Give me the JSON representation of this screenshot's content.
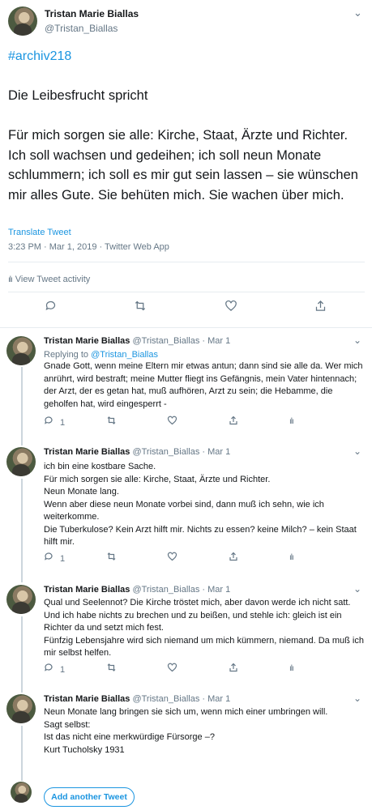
{
  "tweet": {
    "display_name": "Tristan Marie Biallas",
    "handle": "@Tristan_Biallas",
    "hashtag": "#archiv218",
    "body": "Die Leibesfrucht spricht\n\nFür mich sorgen sie alle: Kirche, Staat, Ärzte und Richter. Ich soll wachsen und gedeihen; ich soll neun Monate schlummern; ich soll es mir gut sein lassen – sie wünschen mir alles Gute. Sie behüten mich. Sie wachen über mich.",
    "translate": "Translate Tweet",
    "timestamp": "3:23 PM · Mar 1, 2019 · Twitter Web App",
    "activity": "View Tweet activity",
    "actions": [
      "reply-icon",
      "retweet-icon",
      "like-icon",
      "share-icon"
    ]
  },
  "replies": [
    {
      "name": "Tristan Marie Biallas",
      "meta": "@Tristan_Biallas · Mar 1",
      "replying_prefix": "Replying to ",
      "replying_to": "@Tristan_Biallas",
      "text": "Gnade Gott, wenn meine Eltern mir etwas antun; dann sind sie alle da. Wer mich anrührt, wird bestraft; meine Mutter fliegt ins Gefängnis, mein Vater hintennach; der Arzt, der es getan hat, muß aufhören, Arzt zu sein; die Hebamme, die geholfen hat, wird eingesperrt -",
      "reply_count": "1"
    },
    {
      "name": "Tristan Marie Biallas",
      "meta": "@Tristan_Biallas · Mar 1",
      "text": "ich bin eine kostbare Sache.\nFür mich sorgen sie alle: Kirche, Staat, Ärzte und Richter.\nNeun Monate lang.\nWenn aber diese neun Monate vorbei sind, dann muß ich sehn, wie ich weiterkomme.\nDie Tuberkulose? Kein Arzt hilft mir. Nichts zu essen? keine Milch? – kein Staat hilft mir.",
      "reply_count": "1"
    },
    {
      "name": "Tristan Marie Biallas",
      "meta": "@Tristan_Biallas · Mar 1",
      "text": "Qual und Seelennot? Die Kirche tröstet mich, aber davon werde ich nicht satt. Und ich habe nichts zu brechen und zu beißen, und stehle ich: gleich ist ein Richter da und setzt mich fest.\nFünfzig Lebensjahre wird sich niemand um mich kümmern, niemand. Da muß ich mir selbst helfen.",
      "reply_count": "1"
    },
    {
      "name": "Tristan Marie Biallas",
      "meta": "@Tristan_Biallas · Mar 1",
      "text": "Neun Monate lang bringen sie sich um, wenn mich einer umbringen will.\nSagt selbst:\nIst das nicht eine merkwürdige Fürsorge –?\nKurt Tucholsky 1931",
      "reply_count": ""
    }
  ],
  "add_tweet_label": "Add another Tweet",
  "colors": {
    "accent": "#1b95e0",
    "muted": "#657786",
    "divider": "#e6ecf0"
  }
}
